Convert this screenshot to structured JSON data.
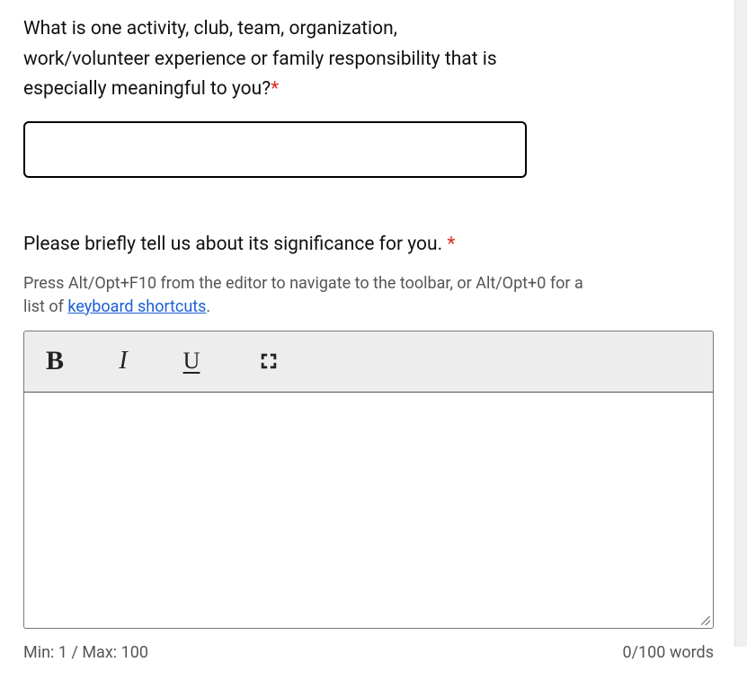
{
  "question1": {
    "label": "What is one activity, club, team, organization, work/volunteer experience or family responsibility that is especially meaningful to you?",
    "required_marker": "*",
    "value": ""
  },
  "question2": {
    "label": "Please briefly tell us about its significance for you. ",
    "required_marker": "*",
    "help_prefix": "Press Alt/Opt+F10 from the editor to navigate to the toolbar, or Alt/Opt+0 for a list of ",
    "help_link_text": "keyboard shortcuts",
    "help_suffix": ".",
    "value": ""
  },
  "toolbar": {
    "bold": "B",
    "italic": "I",
    "underline": "U"
  },
  "footer": {
    "minmax": "Min: 1 / Max: 100",
    "wordcount": "0/100 words"
  }
}
